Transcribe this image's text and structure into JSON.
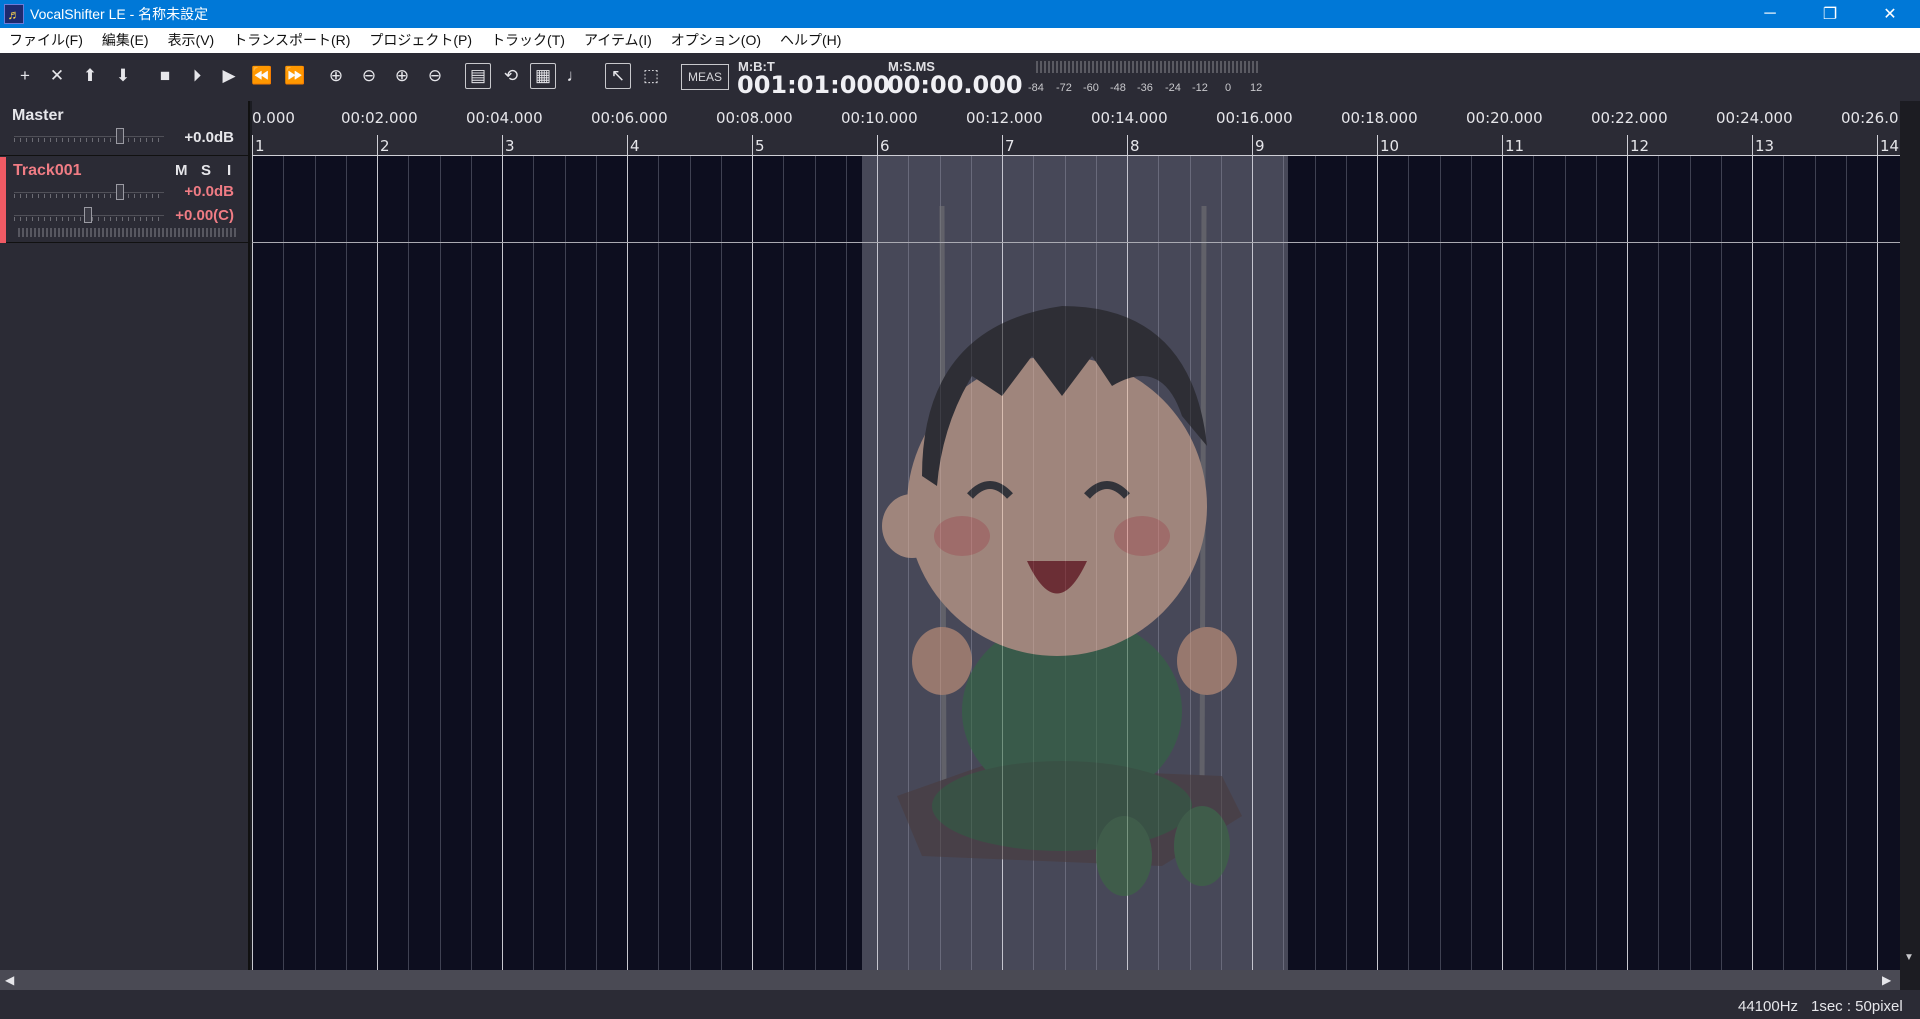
{
  "window": {
    "title": "VocalShifter LE - 名称未設定",
    "icon": "♬",
    "buttons": [
      "─",
      "❐",
      "✕"
    ]
  },
  "menu": [
    "ファイル(F)",
    "編集(E)",
    "表示(V)",
    "トランスポート(R)",
    "プロジェクト(P)",
    "トラック(T)",
    "アイテム(I)",
    "オプション(O)",
    "ヘルプ(H)"
  ],
  "toolbar": {
    "buttons": [
      {
        "name": "add-track",
        "glyph": "+"
      },
      {
        "name": "delete-track",
        "glyph": "✕"
      },
      {
        "name": "move-up",
        "glyph": "⬆"
      },
      {
        "name": "move-down",
        "glyph": "⬇"
      },
      {
        "name": "stop",
        "glyph": "■"
      },
      {
        "name": "play-from-start",
        "glyph": "⏵"
      },
      {
        "name": "play",
        "glyph": "▶"
      },
      {
        "name": "rewind",
        "glyph": "⏪"
      },
      {
        "name": "fast-forward",
        "glyph": "⏩"
      },
      {
        "name": "zoom-in-horizontal",
        "glyph": "⊕"
      },
      {
        "name": "zoom-out-horizontal",
        "glyph": "⊖"
      },
      {
        "name": "zoom-in-vertical",
        "glyph": "⊕"
      },
      {
        "name": "zoom-out-vertical",
        "glyph": "⊖"
      },
      {
        "name": "scroll-follow",
        "glyph": "▤"
      },
      {
        "name": "loop",
        "glyph": "⟲"
      },
      {
        "name": "grid",
        "glyph": "▦"
      },
      {
        "name": "metronome",
        "glyph": "♩"
      },
      {
        "name": "pointer-tool",
        "glyph": "↖"
      },
      {
        "name": "range-select-tool",
        "glyph": "⬚"
      }
    ],
    "meas_label": "MEAS",
    "mbt_label": "M:B:T",
    "mbt_value": "001:01:000",
    "msms_label": "M:S.MS",
    "msms_value": "00:00.000",
    "meter_scale": [
      "-84",
      "-72",
      "-60",
      "-48",
      "-36",
      "-24",
      "-12",
      "0",
      "12"
    ]
  },
  "master": {
    "label": "Master",
    "volume": "+0.0dB"
  },
  "track": {
    "name": "Track001",
    "m": "M",
    "s": "S",
    "i": "I",
    "volume": "+0.0dB",
    "pan": "+0.00(C)",
    "accent_color": "#f05a64"
  },
  "ruler": {
    "times": [
      "0.000",
      "00:02.000",
      "00:04.000",
      "00:06.000",
      "00:08.000",
      "00:10.000",
      "00:12.000",
      "00:14.000",
      "00:16.000",
      "00:18.000",
      "00:20.000",
      "00:22.000",
      "00:24.000",
      "00:26.0"
    ],
    "measures": [
      "1",
      "2",
      "3",
      "4",
      "5",
      "6",
      "7",
      "8",
      "9",
      "10",
      "11",
      "12",
      "13",
      "14"
    ]
  },
  "status": {
    "sample_rate": "44100Hz",
    "scale": "1sec : 50pixel"
  },
  "colors": {
    "titlebar": "#0078d7",
    "canvas": "#0d0e1f",
    "panel": "#2b2b35",
    "track_accent": "#f05a64"
  }
}
